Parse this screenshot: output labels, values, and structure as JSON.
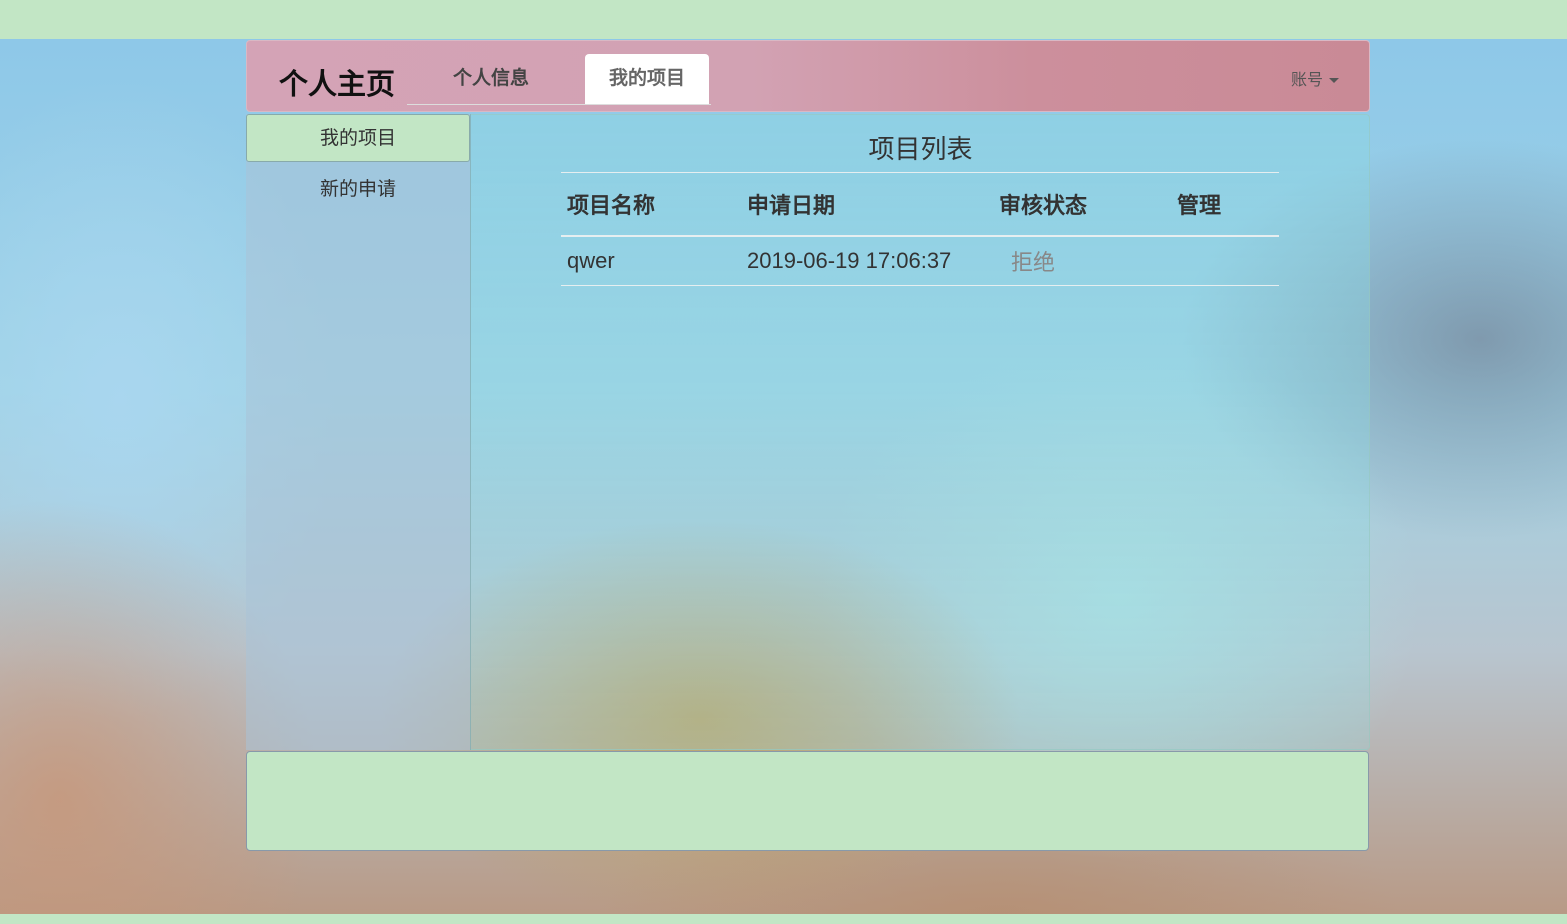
{
  "navbar": {
    "brand": "个人主页",
    "tabs": [
      {
        "label": "个人信息"
      },
      {
        "label": "我的项目"
      }
    ],
    "account_label": "账号"
  },
  "sidebar": {
    "items": [
      {
        "label": "我的项目"
      },
      {
        "label": "新的申请"
      }
    ]
  },
  "main": {
    "title": "项目列表",
    "columns": [
      "项目名称",
      "申请日期",
      "审核状态",
      "管理"
    ],
    "rows": [
      {
        "name": "qwer",
        "date": "2019-06-19 17:06:37",
        "status": "拒绝",
        "manage": ""
      }
    ]
  },
  "colors": {
    "top_band": "#c2e6c5",
    "navbar_pink": "#d2a2b3",
    "active_item": "#c2e6c5",
    "footer": "#c2e6c5",
    "status_text": "#888888"
  }
}
